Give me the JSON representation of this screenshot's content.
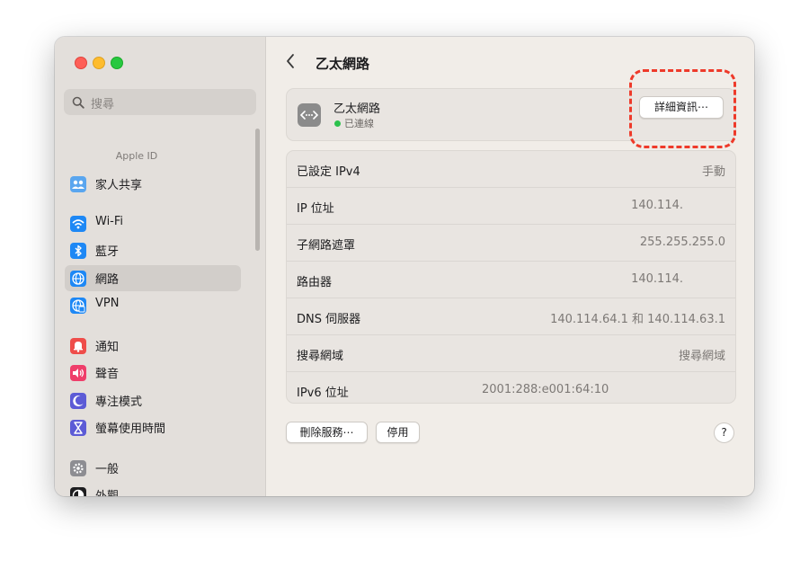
{
  "sidebar": {
    "search_placeholder": "搜尋",
    "section_label": "Apple ID",
    "items": [
      {
        "label": "家人共享",
        "icon": "family-icon",
        "color": "#5aa6ef"
      },
      {
        "label": "Wi-Fi",
        "icon": "wifi-icon",
        "color": "#1e88f5"
      },
      {
        "label": "藍牙",
        "icon": "bluetooth-icon",
        "color": "#1e88f5"
      },
      {
        "label": "網路",
        "icon": "globe-icon",
        "color": "#1e88f5",
        "selected": true
      },
      {
        "label": "VPN",
        "icon": "vpn-globe-icon",
        "color": "#1e88f5"
      },
      {
        "label": "通知",
        "icon": "bell-icon",
        "color": "#ef4d4a"
      },
      {
        "label": "聲音",
        "icon": "speaker-icon",
        "color": "#ef3e6a"
      },
      {
        "label": "專注模式",
        "icon": "moon-icon",
        "color": "#5c5bd6"
      },
      {
        "label": "螢幕使用時間",
        "icon": "hourglass-icon",
        "color": "#5c5bd6"
      },
      {
        "label": "一般",
        "icon": "gear-icon",
        "color": "#8d8d92"
      },
      {
        "label": "外觀",
        "icon": "appearance-icon",
        "color": "#1d1d1f"
      }
    ]
  },
  "main": {
    "title": "乙太網路",
    "interface": {
      "name": "乙太網路",
      "status": "已連線",
      "status_color": "#2cc14c",
      "details_button": "詳細資訊⋯"
    },
    "rows": [
      {
        "label": "已設定 IPv4",
        "value": "手動"
      },
      {
        "label": "IP 位址",
        "value": "140.114."
      },
      {
        "label": "子網路遮罩",
        "value": "255.255.255.0"
      },
      {
        "label": "路由器",
        "value": "140.114."
      },
      {
        "label": "DNS 伺服器",
        "value": "140.114.64.1 和 140.114.63.1"
      },
      {
        "label": "搜尋網域",
        "value": "搜尋網域"
      },
      {
        "label": "IPv6 位址",
        "value": "2001:288:e001:64:10"
      }
    ],
    "delete_button": "刪除服務⋯",
    "disable_button": "停用",
    "help_button": "?"
  },
  "colors": {
    "accent": "#1e88f5",
    "annotation": "#ee3a2a"
  }
}
